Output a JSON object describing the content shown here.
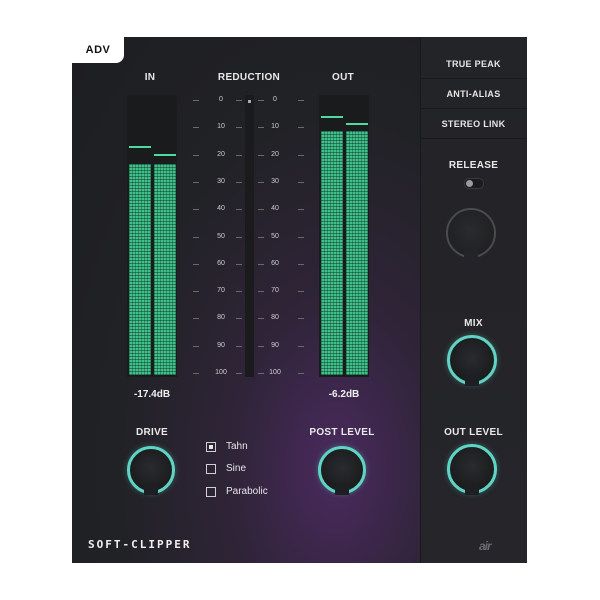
{
  "header": {
    "adv_label": "ADV"
  },
  "meters": {
    "in_label": "IN",
    "reduction_label": "REDUCTION",
    "out_label": "OUT",
    "in_readout": "-17.4dB",
    "out_readout": "-6.2dB",
    "scale": [
      "0",
      "10",
      "20",
      "30",
      "40",
      "50",
      "60",
      "70",
      "80",
      "90",
      "100"
    ]
  },
  "controls": {
    "drive_label": "DRIVE",
    "post_level_label": "POST LEVEL",
    "shapes": [
      {
        "label": "Tahn",
        "checked": true
      },
      {
        "label": "Sine",
        "checked": false
      },
      {
        "label": "Parabolic",
        "checked": false
      }
    ]
  },
  "side": {
    "buttons": [
      "TRUE PEAK",
      "ANTI-ALIAS",
      "STEREO LINK"
    ],
    "release_label": "RELEASE",
    "mix_label": "MIX",
    "out_level_label": "OUT LEVEL"
  },
  "brand": {
    "name": "SOFT-CLIPPER",
    "logo": "air"
  },
  "colors": {
    "accent": "#5fd3c4",
    "meter": "#3fbf8a"
  }
}
